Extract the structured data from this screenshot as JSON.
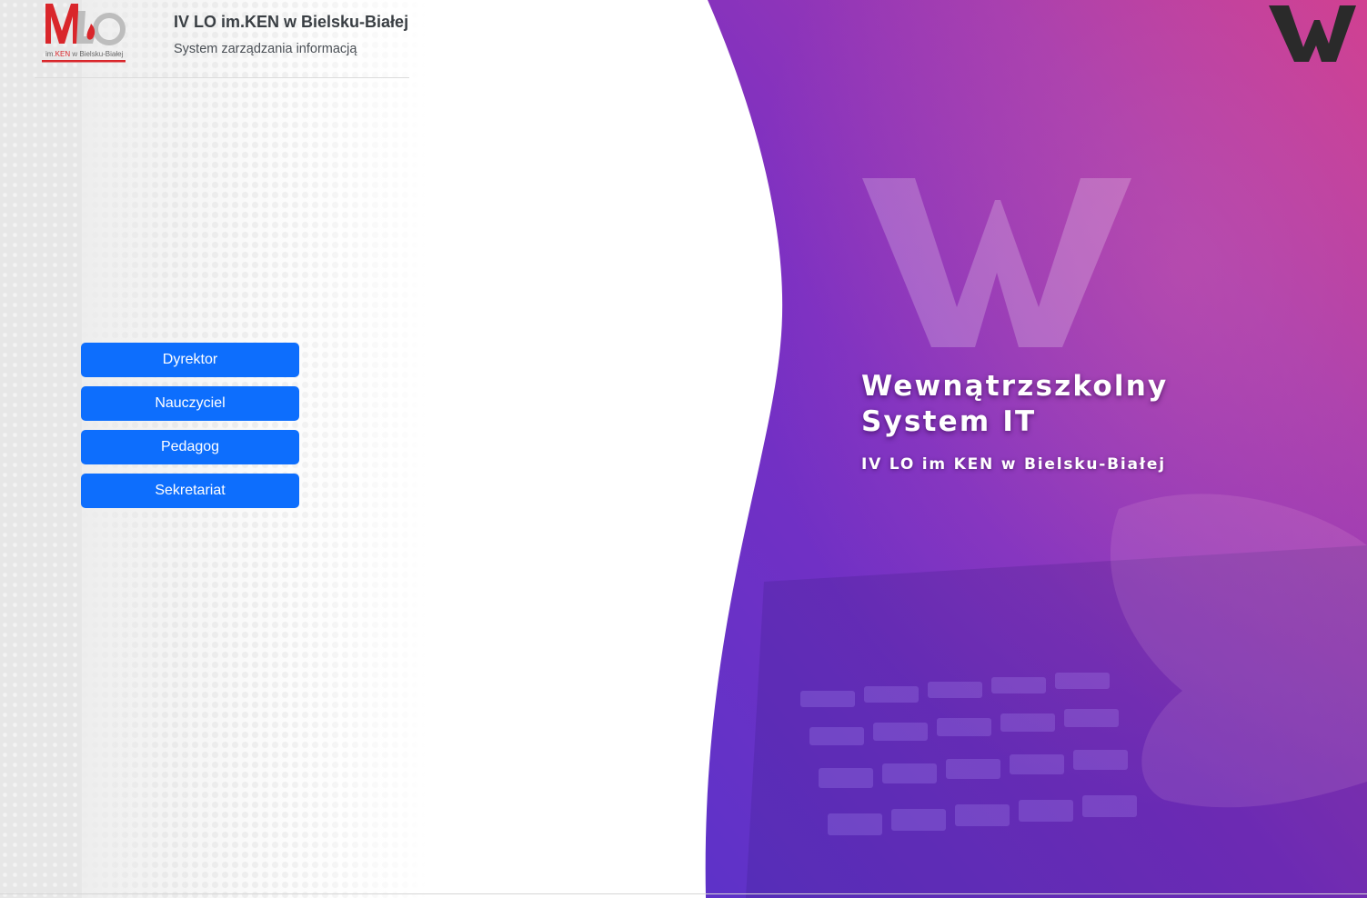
{
  "header": {
    "school_name": "IV LO im.KEN w Bielsku-Białej",
    "subtitle": "System zarządzania informacją",
    "logo_text": "im.KEN w Bielsku-Białej"
  },
  "roles": [
    {
      "label": "Dyrektor"
    },
    {
      "label": "Nauczyciel"
    },
    {
      "label": "Pedagog"
    },
    {
      "label": "Sekretariat"
    }
  ],
  "hero": {
    "title_line1": "Wewnątrzszkolny",
    "title_line2": "System IT",
    "subtitle": "IV LO im KEN w Bielsku-Białej",
    "watermark_letter": "W",
    "brand_letter": "W"
  },
  "colors": {
    "button": "#0d6efd",
    "hero_pink": "#c2338f",
    "hero_purple": "#6a2fc8",
    "hero_violet": "#8a2fc0"
  }
}
